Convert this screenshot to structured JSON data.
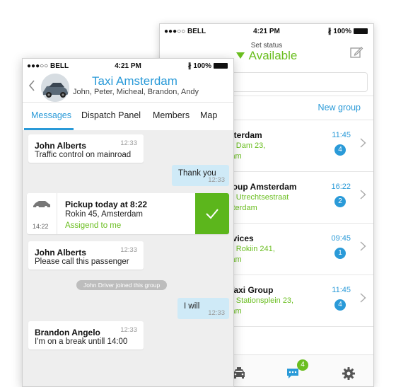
{
  "back_screen": {
    "status_bar": {
      "signal": "●●●○○ BELL",
      "time": "4:21 PM",
      "battery": "100%"
    },
    "set_status_label": "Set status",
    "status_value": "Available",
    "new_group_label": "New group",
    "groups": [
      {
        "name": "sterdam",
        "line1": "r: Dam 23,",
        "line2": "lam",
        "time": "11:45",
        "unread": "4"
      },
      {
        "name": "roup Amsterdam",
        "line1": "r: Utrechtsestraat",
        "line2": "sterdam",
        "time": "16:22",
        "unread": "2"
      },
      {
        "name": "rvices",
        "line1": "r: Rokiin 241,",
        "line2": "lam",
        "time": "09:45",
        "unread": "1"
      },
      {
        "name": "Taxi Group",
        "line1": "r: Stationsplein 23,",
        "line2": "lam",
        "time": "11:45",
        "unread": "4"
      }
    ],
    "tabbar": {
      "chat_badge": "4"
    },
    "colors": {
      "accent_green": "#6abe1f",
      "accent_blue": "#2a9ad8"
    }
  },
  "front_screen": {
    "status_bar": {
      "signal": "●●●○○ BELL",
      "time": "4:21 PM",
      "battery": "100%"
    },
    "title": "Taxi Amsterdam",
    "members_line": "John, Peter, Micheal, Brandon, Andy",
    "tabs": [
      "Messages",
      "Dispatch Panel",
      "Members",
      "Map"
    ],
    "messages": [
      {
        "sender": "John Alberts",
        "text": "Traffic control on mainroad",
        "time": "12:33"
      },
      {
        "text": "Thank you",
        "time": "12:33"
      },
      {
        "sender": "John Alberts",
        "text": "Please call this passenger",
        "time": "12:33"
      },
      {
        "text": "I will",
        "time": "12:33"
      },
      {
        "sender": "Brandon Angelo",
        "text": "I'm on a break untill 14:00",
        "time": "12:33"
      }
    ],
    "pickup": {
      "title": "Pickup today at 8:22",
      "address": "Rokin 45, Amsterdam",
      "status": "Assigend to me",
      "time": "14:22"
    },
    "system_notice": "John Driver joined this group"
  }
}
